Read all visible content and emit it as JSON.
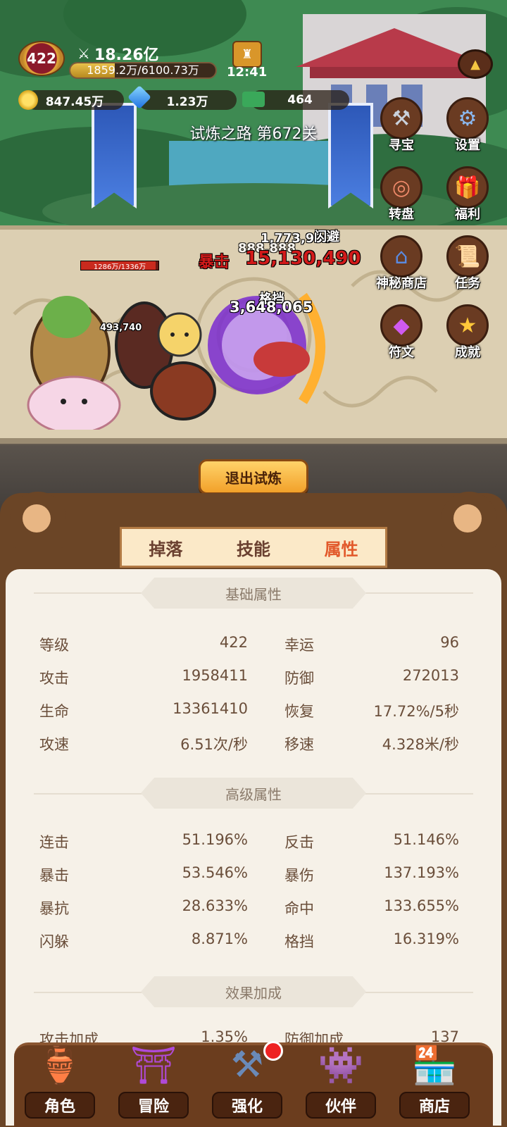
{
  "hud": {
    "level": "422",
    "power": "18.26亿",
    "xp_text": "1859.2万/6100.73万",
    "xp_fraction": 0.305,
    "timer": "12:41",
    "gold": "847.45万",
    "gems": "1.23万",
    "cash": "464"
  },
  "stage": {
    "title": "试炼之路 第672关",
    "exit_button": "退出试炼",
    "enemy_hp": "1286万/1336万",
    "dmg_crit_label": "暴击",
    "dmg_crit_value": "15,130,490",
    "dmg_top_a": "1,773,990",
    "dmg_top_b": "888,888",
    "dmg_top_label": "闪避",
    "dmg_block_label": "格挡",
    "dmg_block_value": "3,648,065",
    "dmg_small": "493,740"
  },
  "side_menu": [
    {
      "label": "寻宝",
      "icon": "hammer-icon"
    },
    {
      "label": "设置",
      "icon": "gear-icon"
    },
    {
      "label": "转盘",
      "icon": "wheel-icon"
    },
    {
      "label": "福利",
      "icon": "gift-icon"
    },
    {
      "label": "神秘商店",
      "icon": "shop-icon"
    },
    {
      "label": "任务",
      "icon": "scroll-icon"
    },
    {
      "label": "符文",
      "icon": "crystal-icon"
    },
    {
      "label": "成就",
      "icon": "star-icon"
    }
  ],
  "tabs": [
    "掉落",
    "技能",
    "属性"
  ],
  "active_tab": 2,
  "sections": {
    "basic": {
      "title": "基础属性",
      "rows": [
        [
          "等级",
          "422",
          "幸运",
          "96"
        ],
        [
          "攻击",
          "1958411",
          "防御",
          "272013"
        ],
        [
          "生命",
          "13361410",
          "恢复",
          "17.72%/5秒"
        ],
        [
          "攻速",
          "6.51次/秒",
          "移速",
          "4.328米/秒"
        ]
      ]
    },
    "advanced": {
      "title": "高级属性",
      "rows": [
        [
          "连击",
          "51.196%",
          "反击",
          "51.146%"
        ],
        [
          "暴击",
          "53.546%",
          "暴伤",
          "137.193%"
        ],
        [
          "暴抗",
          "28.633%",
          "命中",
          "133.655%"
        ],
        [
          "闪躲",
          "8.871%",
          "格挡",
          "16.319%"
        ]
      ]
    },
    "bonus": {
      "title": "效果加成",
      "partial_row": [
        "攻击加成",
        "1.35%",
        "防御加成",
        "137"
      ]
    }
  },
  "nav": [
    {
      "label": "角色",
      "icon": "gold-pot-icon"
    },
    {
      "label": "冒险",
      "icon": "portal-icon"
    },
    {
      "label": "强化",
      "icon": "anvil-icon"
    },
    {
      "label": "伙伴",
      "icon": "partner-icon"
    },
    {
      "label": "商店",
      "icon": "store-icon"
    }
  ],
  "colors": {
    "active_tab": "#e2592b",
    "inactive_tab": "#6a4030",
    "crit": "#d21a1a"
  }
}
